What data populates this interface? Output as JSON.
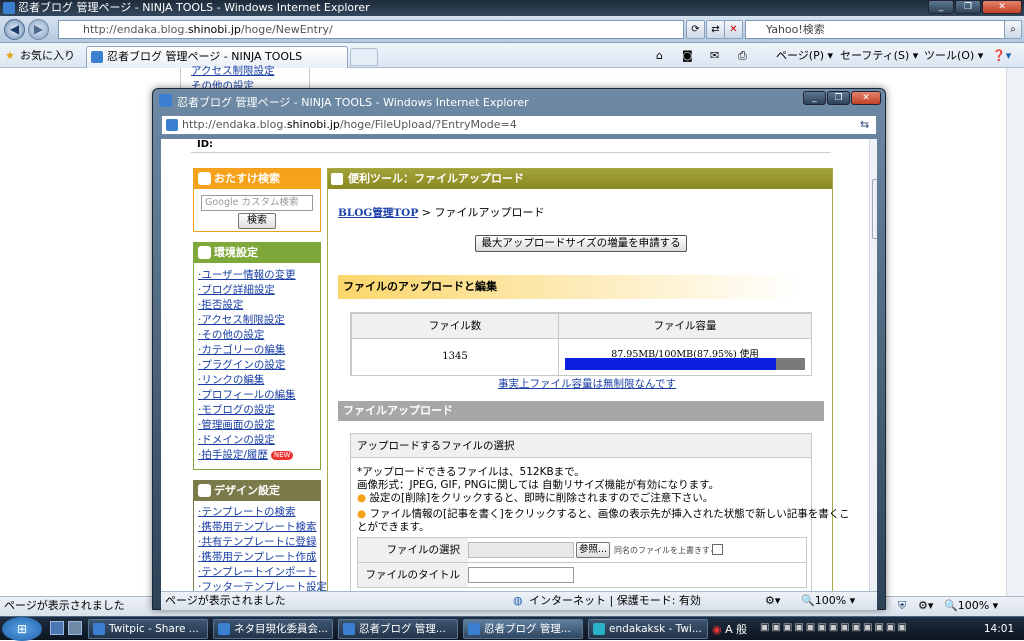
{
  "main_window": {
    "title": "忍者ブログ 管理ページ - NINJA TOOLS - Windows Internet Explorer",
    "address_prefix": "http://endaka.blog.",
    "address_host": "shinobi.jp",
    "address_suffix": "/hoge/NewEntry/",
    "search_placeholder": "Yahoo!検索",
    "favorites_label": "お気に入り",
    "tab_title": "忍者ブログ 管理ページ - NINJA TOOLS",
    "cmd_page": "ページ(P)",
    "cmd_safety": "セーフティ(S)",
    "cmd_tools": "ツール(O)",
    "status_text": "ページが表示されました",
    "zoom": "100%",
    "bg_links": [
      "アクセス制限設定",
      "その他の設定"
    ]
  },
  "popup": {
    "title": "忍者ブログ 管理ページ - NINJA TOOLS - Windows Internet Explorer",
    "address_prefix": "http://endaka.blog.",
    "address_host": "shinobi.jp",
    "address_suffix": "/hoge/FileUpload/?EntryMode=4",
    "status_text": "ページが表示されました",
    "zone_text": "インターネット | 保護モード: 有効",
    "zoom": "100%"
  },
  "page": {
    "top_id_label": "ID:",
    "sidebar": {
      "search_head": "おたすけ検索",
      "search_placeholder": "Google カスタム検索",
      "search_button": "検索",
      "env_head": "環境設定",
      "env_links": [
        "ユーザー情報の変更",
        "ブログ詳細設定",
        "拒否設定",
        "アクセス制限設定",
        "その他の設定",
        "カテゴリーの編集",
        "プラグインの設定",
        "リンクの編集",
        "プロフィールの編集",
        "モブログの設定",
        "管理画面の設定",
        "ドメインの設定",
        "拍手設定/履歴"
      ],
      "new_badge": "NEW",
      "design_head": "デザイン設定",
      "design_links": [
        "テンプレートの検索",
        "携帯用テンプレート検索",
        "共有テンプレートに登録",
        "携帯用テンプレート作成",
        "テンプレートインポート",
        "フッターテンプレート設定"
      ]
    },
    "main": {
      "header": "便利ツール：ファイルアップロード",
      "breadcrumb_link": "BLOG管理TOP",
      "breadcrumb_rest": " > ファイルアップロード",
      "request_button": "最大アップロードサイズの増量を申請する",
      "section1": "ファイルのアップロードと編集",
      "col_count": "ファイル数",
      "col_size": "ファイル容量",
      "file_count": "1345",
      "usage_text": "87.95MB/100MB(87.95%) 使用",
      "usage_fraction": 0.8795,
      "unlimited_link": "事実上ファイル容量は無制限なんです",
      "section2": "ファイルアップロード",
      "select_head": "アップロードするファイルの選択",
      "note1": "*アップロードできるファイルは、512KBまで。",
      "note2": "画像形式：JPEG, GIF, PNGに関しては 自動リサイズ機能が有効になります。",
      "note3": "設定の[削除]をクリックすると、即時に削除されますのでご注意下さい。",
      "note4a": "ファイル情報の[記事を書く]をクリックすると、画像の表示先が挿入された状態で新しい記事を書くこ",
      "note4b": "とができます。",
      "label_file": "ファイルの選択",
      "browse": "参照...",
      "overwrite": "同名のファイルを上書きする",
      "label_title": "ファイルのタイトル"
    }
  },
  "taskbar": {
    "buttons": [
      "Twitpic - Share ...",
      "ネタ目現化委員会...",
      "忍者ブログ 管理...",
      "忍者ブログ 管理...",
      "endakaksk - Twi..."
    ],
    "ime": "A 般",
    "clock": "14:01"
  },
  "colors": {
    "orange": "#f7a21b",
    "green": "#7fa83a",
    "olive": "#9a9a2c",
    "gray_head": "#a7a7a7",
    "bar_blue": "#0a1fe0",
    "link": "#1a3fa5"
  }
}
